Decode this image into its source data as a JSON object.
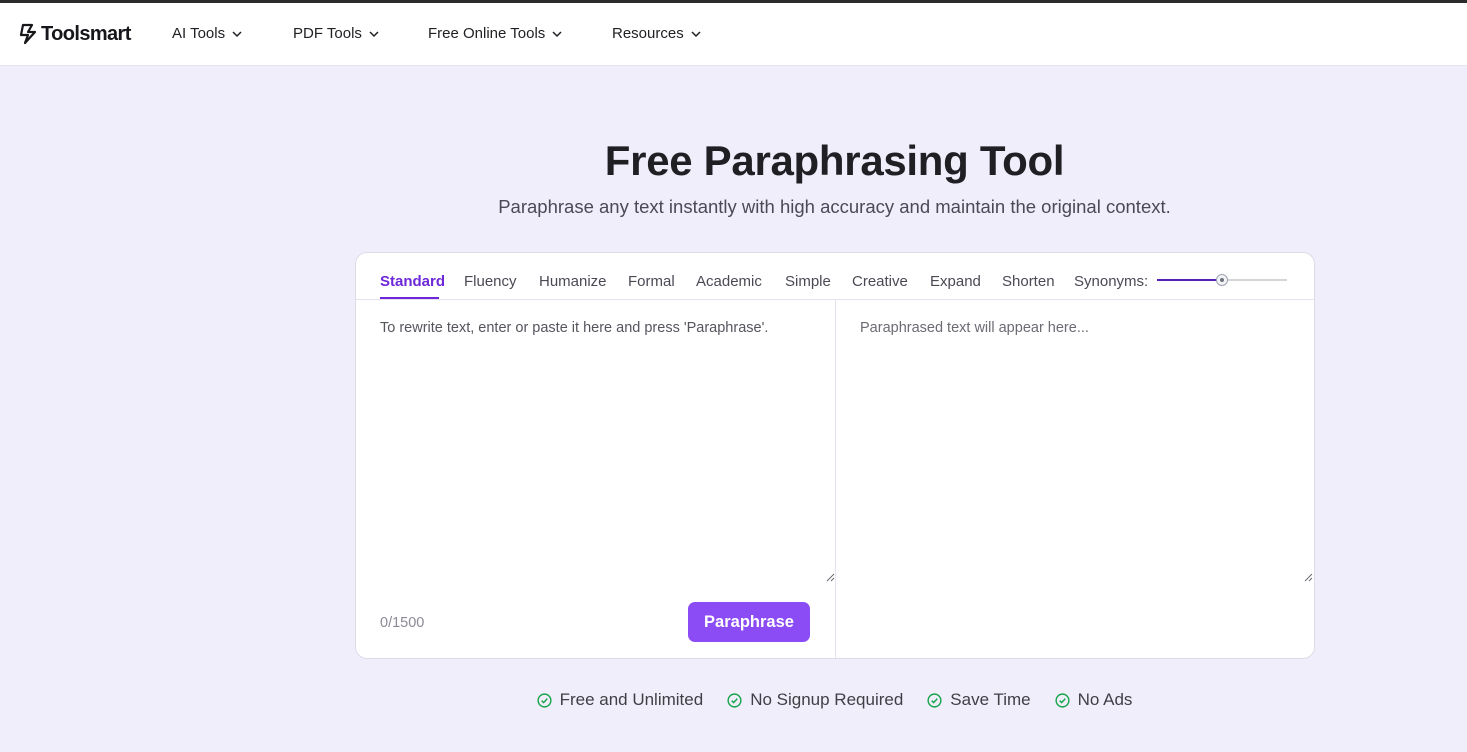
{
  "brand": {
    "name": "Toolsmart"
  },
  "nav": {
    "items": [
      {
        "label": "AI Tools"
      },
      {
        "label": "PDF Tools"
      },
      {
        "label": "Free Online Tools"
      },
      {
        "label": "Resources"
      }
    ]
  },
  "hero": {
    "title": "Free Paraphrasing Tool",
    "subtitle": "Paraphrase any text instantly with high accuracy and maintain the original context."
  },
  "tool": {
    "modes": [
      "Standard",
      "Fluency",
      "Humanize",
      "Formal",
      "Academic",
      "Simple",
      "Creative",
      "Expand",
      "Shorten"
    ],
    "active_mode": "Standard",
    "synonyms_label": "Synonyms:",
    "synonyms_level": 0.5,
    "input_placeholder": "To rewrite text, enter or paste it here and press 'Paraphrase'.",
    "output_placeholder": "Paraphrased text will appear here...",
    "char_count": "0/1500",
    "paraphrase_label": "Paraphrase"
  },
  "features": [
    "Free and Unlimited",
    "No Signup Required",
    "Save Time",
    "No Ads"
  ],
  "colors": {
    "accent": "#6d28d9",
    "button": "#8b4cf5",
    "background": "#f1eefb",
    "check": "#16a34a"
  }
}
